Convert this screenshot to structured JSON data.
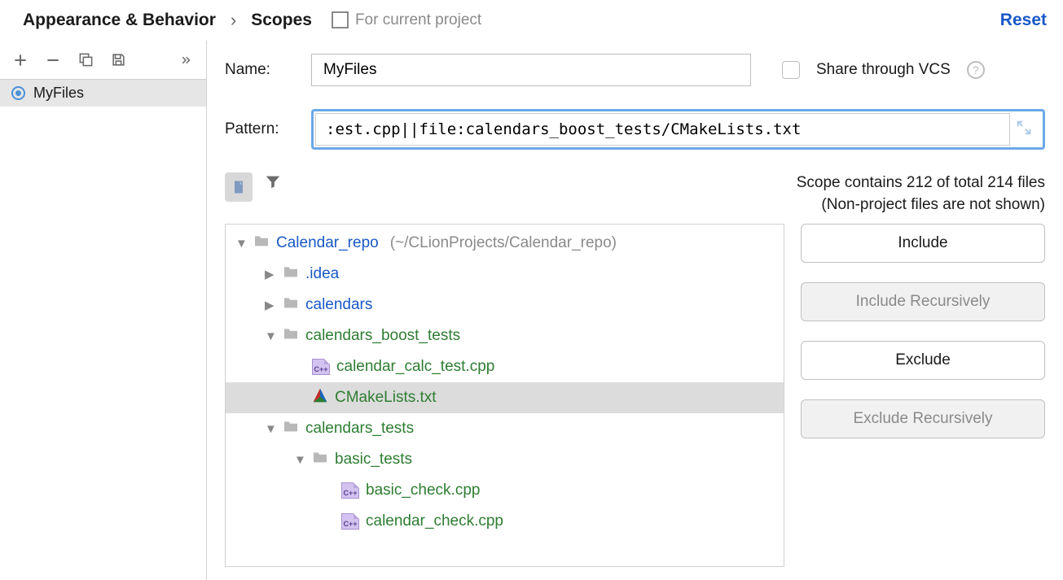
{
  "breadcrumb": {
    "parent": "Appearance & Behavior",
    "current": "Scopes"
  },
  "projectBadge": "For current project",
  "resetLabel": "Reset",
  "sidebar": {
    "items": [
      {
        "label": "MyFiles"
      }
    ]
  },
  "form": {
    "nameLabel": "Name:",
    "nameValue": "MyFiles",
    "shareLabel": "Share through VCS",
    "patternLabel": "Pattern:",
    "patternValue": ":est.cpp||file:calendars_boost_tests/CMakeLists.txt"
  },
  "status": {
    "line1": "Scope contains 212 of total 214 files",
    "line2": "(Non-project files are not shown)"
  },
  "buttons": {
    "include": "Include",
    "includeRec": "Include Recursively",
    "exclude": "Exclude",
    "excludeRec": "Exclude Recursively"
  },
  "tree": [
    {
      "indent": 0,
      "arrow": "down",
      "icon": "folder",
      "label": "Calendar_repo",
      "hint": "(~/CLionProjects/Calendar_repo)",
      "color": "blue"
    },
    {
      "indent": 1,
      "arrow": "right",
      "icon": "folder",
      "label": ".idea",
      "color": "blue"
    },
    {
      "indent": 1,
      "arrow": "right",
      "icon": "folder",
      "label": "calendars",
      "color": "blue"
    },
    {
      "indent": 1,
      "arrow": "down",
      "icon": "folder",
      "label": "calendars_boost_tests",
      "color": "green"
    },
    {
      "indent": 2,
      "arrow": "",
      "icon": "cpp",
      "label": "calendar_calc_test.cpp",
      "color": "green"
    },
    {
      "indent": 2,
      "arrow": "",
      "icon": "cmake",
      "label": "CMakeLists.txt",
      "color": "green",
      "selected": true
    },
    {
      "indent": 1,
      "arrow": "down",
      "icon": "folder",
      "label": "calendars_tests",
      "color": "green"
    },
    {
      "indent": 2,
      "arrow": "down",
      "icon": "folder",
      "label": "basic_tests",
      "color": "green"
    },
    {
      "indent": 3,
      "arrow": "",
      "icon": "cpp",
      "label": "basic_check.cpp",
      "color": "green"
    },
    {
      "indent": 3,
      "arrow": "",
      "icon": "cpp",
      "label": "calendar_check.cpp",
      "color": "green"
    }
  ],
  "cppIconText": "C++"
}
